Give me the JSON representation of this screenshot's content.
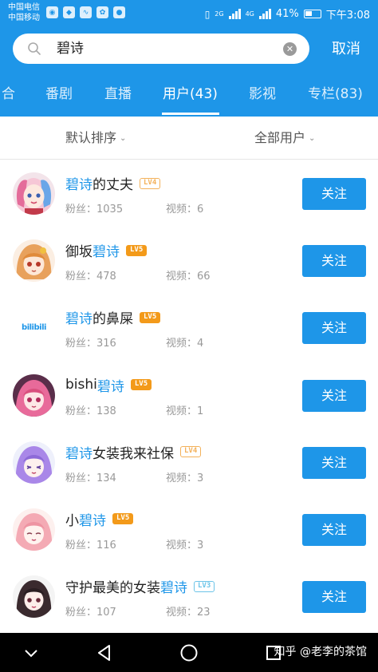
{
  "status_bar": {
    "carrier1": "中国电信",
    "carrier2": "中国移动",
    "net": "2G",
    "net2": "4G",
    "battery": "41%",
    "time": "下午3:08"
  },
  "search": {
    "query": "碧诗",
    "cancel_label": "取消"
  },
  "tabs": [
    {
      "label": "合",
      "active": false
    },
    {
      "label": "番剧",
      "active": false
    },
    {
      "label": "直播",
      "active": false
    },
    {
      "label": "用户(43)",
      "active": true
    },
    {
      "label": "影视",
      "active": false
    },
    {
      "label": "专栏(83)",
      "active": false
    }
  ],
  "sort": {
    "order_label": "默认排序",
    "filter_label": "全部用户"
  },
  "colors": {
    "accent": "#1e96e8",
    "level_orange": "#f39a1a",
    "level_blue": "#6cc4e8"
  },
  "users": [
    {
      "name_pre": "",
      "name_hl": "碧诗",
      "name_post": "的丈夫",
      "level": "LV4",
      "fans": "粉丝：1035",
      "videos": "视频：6",
      "follow": "关注",
      "avatar": "harley-avatar"
    },
    {
      "name_pre": "御坂",
      "name_hl": "碧诗",
      "name_post": "",
      "level": "LV5",
      "fans": "粉丝：478",
      "videos": "视频：66",
      "follow": "关注",
      "avatar": "misaka-avatar"
    },
    {
      "name_pre": "",
      "name_hl": "碧诗",
      "name_post": "的鼻屎",
      "level": "LV5",
      "fans": "粉丝：316",
      "videos": "视频：4",
      "follow": "关注",
      "avatar": "bilibili-logo-avatar",
      "avatar_text": "bilibili"
    },
    {
      "name_pre": "bishi",
      "name_hl": "碧诗",
      "name_post": "",
      "level": "LV5",
      "fans": "粉丝：138",
      "videos": "视频：1",
      "follow": "关注",
      "avatar": "pink-hair-avatar"
    },
    {
      "name_pre": "",
      "name_hl": "碧诗",
      "name_post": "女装我来社保",
      "level": "LV4",
      "fans": "粉丝：134",
      "videos": "视频：3",
      "follow": "关注",
      "avatar": "purple-hair-avatar"
    },
    {
      "name_pre": "小",
      "name_hl": "碧诗",
      "name_post": "",
      "level": "LV5",
      "fans": "粉丝：116",
      "videos": "视频：3",
      "follow": "关注",
      "avatar": "peach-hair-avatar"
    },
    {
      "name_pre": "守护最美的女装",
      "name_hl": "碧诗",
      "name_post": "",
      "level": "LV3",
      "fans": "粉丝：107",
      "videos": "视频：23",
      "follow": "关注",
      "avatar": "dark-hair-avatar"
    }
  ],
  "watermark": "知乎 @老李的茶馆"
}
